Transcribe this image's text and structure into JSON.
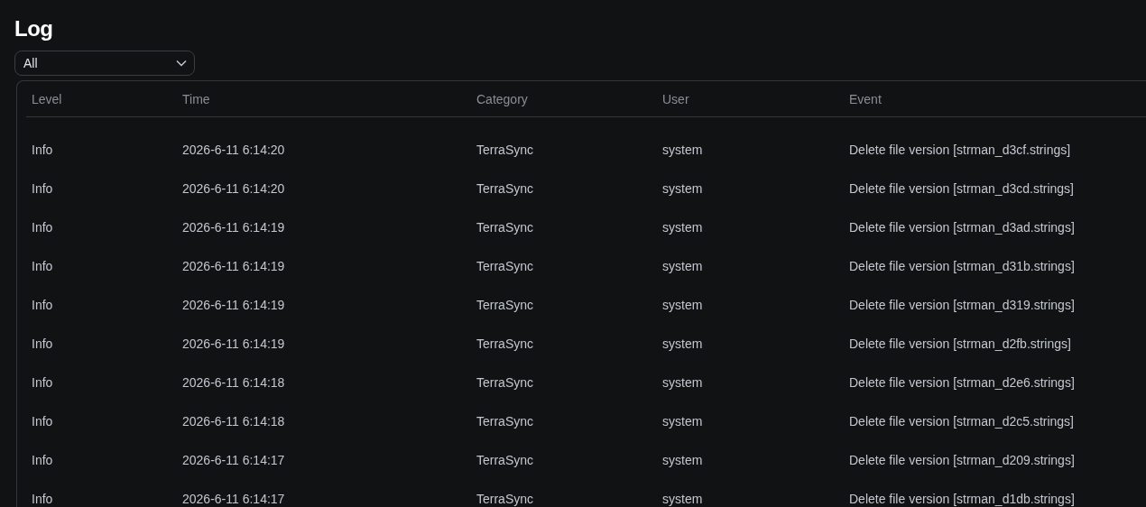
{
  "title": "Log",
  "filter": {
    "value": "All"
  },
  "table": {
    "columns": [
      "Level",
      "Time",
      "Category",
      "User",
      "Event"
    ],
    "rows": [
      [
        "Info",
        "2026-6-11 6:14:20",
        "TerraSync",
        "system",
        "Delete file version [strman_d3cf.strings]"
      ],
      [
        "Info",
        "2026-6-11 6:14:20",
        "TerraSync",
        "system",
        "Delete file version [strman_d3cd.strings]"
      ],
      [
        "Info",
        "2026-6-11 6:14:19",
        "TerraSync",
        "system",
        "Delete file version [strman_d3ad.strings]"
      ],
      [
        "Info",
        "2026-6-11 6:14:19",
        "TerraSync",
        "system",
        "Delete file version [strman_d31b.strings]"
      ],
      [
        "Info",
        "2026-6-11 6:14:19",
        "TerraSync",
        "system",
        "Delete file version [strman_d319.strings]"
      ],
      [
        "Info",
        "2026-6-11 6:14:19",
        "TerraSync",
        "system",
        "Delete file version [strman_d2fb.strings]"
      ],
      [
        "Info",
        "2026-6-11 6:14:18",
        "TerraSync",
        "system",
        "Delete file version [strman_d2e6.strings]"
      ],
      [
        "Info",
        "2026-6-11 6:14:18",
        "TerraSync",
        "system",
        "Delete file version [strman_d2c5.strings]"
      ],
      [
        "Info",
        "2026-6-11 6:14:17",
        "TerraSync",
        "system",
        "Delete file version [strman_d209.strings]"
      ],
      [
        "Info",
        "2026-6-11 6:14:17",
        "TerraSync",
        "system",
        "Delete file version [strman_d1db.strings]"
      ]
    ]
  }
}
